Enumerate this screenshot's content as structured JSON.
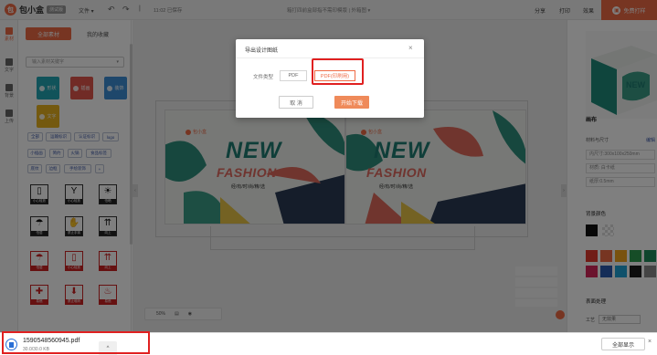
{
  "app": {
    "logo_text": "包小盒",
    "logo_badge": "测试版",
    "menu_file": "文件 ▾",
    "saved_status": "11:02 已保存",
    "doc_title": "箱打四前盒部指不需印模版 | 外箱图 ▾",
    "share": "分享",
    "print": "打印",
    "sample": "效果",
    "buy_label": "免费打样"
  },
  "rail": {
    "items": [
      {
        "label": "素材"
      },
      {
        "label": "文字"
      },
      {
        "label": "背景"
      },
      {
        "label": "上传"
      }
    ]
  },
  "panel": {
    "tab_all": "全部素材",
    "tab_mine": "我的收藏",
    "search_placeholder": "输入素材关键字",
    "categories": [
      {
        "label": "形状",
        "color": "#22a7b5"
      },
      {
        "label": "插画",
        "color": "#e2574c"
      },
      {
        "label": "装饰",
        "color": "#3d8fd6"
      },
      {
        "label": "文字",
        "color": "#e8b21f"
      }
    ],
    "tags": [
      "全部",
      "运输标识",
      "认证标识",
      "logo",
      "小插画",
      "简约",
      "火锅",
      "食品标签",
      "底纹",
      "边框",
      "手绘装饰",
      "+"
    ],
    "symbols": [
      {
        "glyph": "▯",
        "caption": "小心轻放",
        "red": false
      },
      {
        "glyph": "🍷",
        "caption": "小心轻放",
        "red": false
      },
      {
        "glyph": "☀",
        "caption": "怕晒",
        "red": false
      },
      {
        "glyph": "☂",
        "caption": "怕湿",
        "red": false
      },
      {
        "glyph": "✋",
        "caption": "禁止手钩",
        "red": false
      },
      {
        "glyph": "⇈",
        "caption": "向上",
        "red": false
      },
      {
        "glyph": "☂",
        "caption": "怕湿",
        "red": true
      },
      {
        "glyph": "▯",
        "caption": "小心轻放",
        "red": true
      },
      {
        "glyph": "⇈",
        "caption": "向上",
        "red": true
      },
      {
        "glyph": "✚",
        "caption": "易燃",
        "red": true
      },
      {
        "glyph": "⬇",
        "caption": "禁止堆码",
        "red": true
      },
      {
        "glyph": "🔥",
        "caption": "易燃",
        "red": true
      }
    ]
  },
  "canvas": {
    "logo": "包小盒",
    "headline": "NEW",
    "subhead": "FASHION",
    "tagline": "经/有/时/尚/精/选",
    "zoom": "50%"
  },
  "right": {
    "sec_canvas": "画布",
    "size_label": "材料与尺寸",
    "edit": "编辑",
    "dims": "内尺寸:300x100x250mm",
    "material": "材质: 白卡纸",
    "thickness": "纸厚:0.5mm",
    "bg_color": "背景颜色",
    "surface": "表面处理",
    "process_label": "工艺",
    "process_value": "无效果",
    "swatches": [
      "#111111",
      "#e4e4e4",
      "#e23b2e",
      "#ef6a45",
      "#f2a51c",
      "#2c9a4e",
      "#1e8a5a",
      "#d6265b",
      "#2a5ab0",
      "#1ea3d6",
      "#1a1a1a",
      "#888888"
    ]
  },
  "modal": {
    "title": "导出设计图纸",
    "close": "×",
    "file_type_label": "文件类型",
    "opt_pdf": "PDF",
    "opt_pdf_print": "PDF(印刷用)",
    "cancel": "取 消",
    "confirm": "开始下载"
  },
  "download": {
    "filename": "1590548560945.pdf",
    "size": "30.0/30.0 KB",
    "more": "^",
    "show_all": "全部显示",
    "close": "×"
  }
}
